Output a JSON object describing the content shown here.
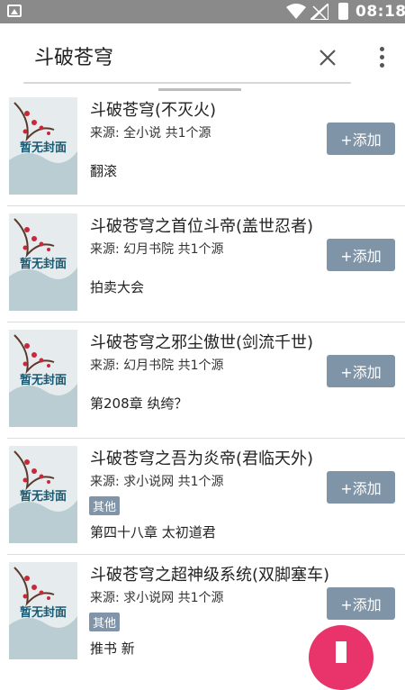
{
  "status_bar": {
    "time": "08:18"
  },
  "search": {
    "query": "斗破苍穹"
  },
  "colors": {
    "accent": "#e8336b",
    "add_button": "#7f94a7",
    "tag": "#8095aa",
    "status_bar": "#8a8a8a"
  },
  "results": [
    {
      "title": "斗破苍穹(不灭火)",
      "source": "来源: 全小说  共1个源",
      "tag": "",
      "latest": "翻滚",
      "add_label": "+添加",
      "cover_text": "暂无封面"
    },
    {
      "title": "斗破苍穹之首位斗帝(盖世忍者)",
      "source": "来源: 幻月书院  共1个源",
      "tag": "",
      "latest": "拍卖大会",
      "add_label": "+添加",
      "cover_text": "暂无封面"
    },
    {
      "title": "斗破苍穹之邪尘傲世(剑流千世)",
      "source": "来源: 幻月书院  共1个源",
      "tag": "",
      "latest": "第208章 纨绔？",
      "add_label": "+添加",
      "cover_text": "暂无封面"
    },
    {
      "title": "斗破苍穹之吾为炎帝(君临天外)",
      "source": "来源: 求小说网  共1个源",
      "tag": "其他",
      "latest": "第四十八章 太初道君",
      "add_label": "+添加",
      "cover_text": "暂无封面"
    },
    {
      "title": "斗破苍穹之超神级系统(双脚塞车)",
      "source": "来源: 求小说网  共1个源",
      "tag": "其他",
      "latest": "推书 新",
      "add_label": "+添加",
      "cover_text": "暂无封面"
    }
  ]
}
